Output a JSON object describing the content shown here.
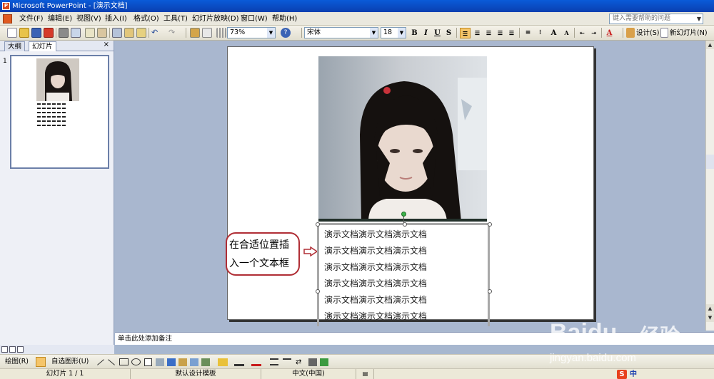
{
  "window": {
    "title": "Microsoft PowerPoint - [演示文档]"
  },
  "menu": {
    "items": [
      "文件(F)",
      "编辑(E)",
      "视图(V)",
      "插入(I)",
      "格式(O)",
      "工具(T)",
      "幻灯片放映(D)",
      "窗口(W)",
      "帮助(H)"
    ],
    "help_placeholder": "键入需要帮助的问题"
  },
  "toolbar": {
    "zoom": "73%",
    "font_name": "宋体",
    "font_size": "18",
    "bold": "B",
    "italic": "I",
    "underline": "U",
    "shadow": "S",
    "design_label": "设计(S)",
    "new_slide_label": "新幻灯片(N)"
  },
  "panel": {
    "tab_outline": "大纲",
    "tab_slides": "幻灯片",
    "close": "×",
    "slide_number": "1"
  },
  "slide": {
    "callout_text": "在合适位置插入一个文本框",
    "callout_line1": "在合适位置插",
    "callout_line2": "入一个文本框",
    "textbox_lines": [
      "演示文档演示文档演示文档",
      "演示文档演示文档演示文档",
      "演示文档演示文档演示文档",
      "演示文档演示文档演示文档",
      "演示文档演示文档演示文档",
      "演示文档演示文档演示文档"
    ]
  },
  "notes": {
    "placeholder": "单击此处添加备注"
  },
  "drawbar": {
    "draw_label": "绘图(R)",
    "autoshapes_label": "自选图形(U)"
  },
  "status": {
    "slide_indicator": "幻灯片 1 / 1",
    "template": "默认设计模板",
    "language": "中文(中国)",
    "ime_label": "中"
  },
  "watermark": {
    "brand": "Baidu",
    "brand_cn": "经验",
    "url": "jingyan.baidu.com"
  },
  "colors": {
    "titlebar": "#0a4fc8",
    "callout_border": "#b02e35",
    "workspace": "#a9b7cf"
  }
}
